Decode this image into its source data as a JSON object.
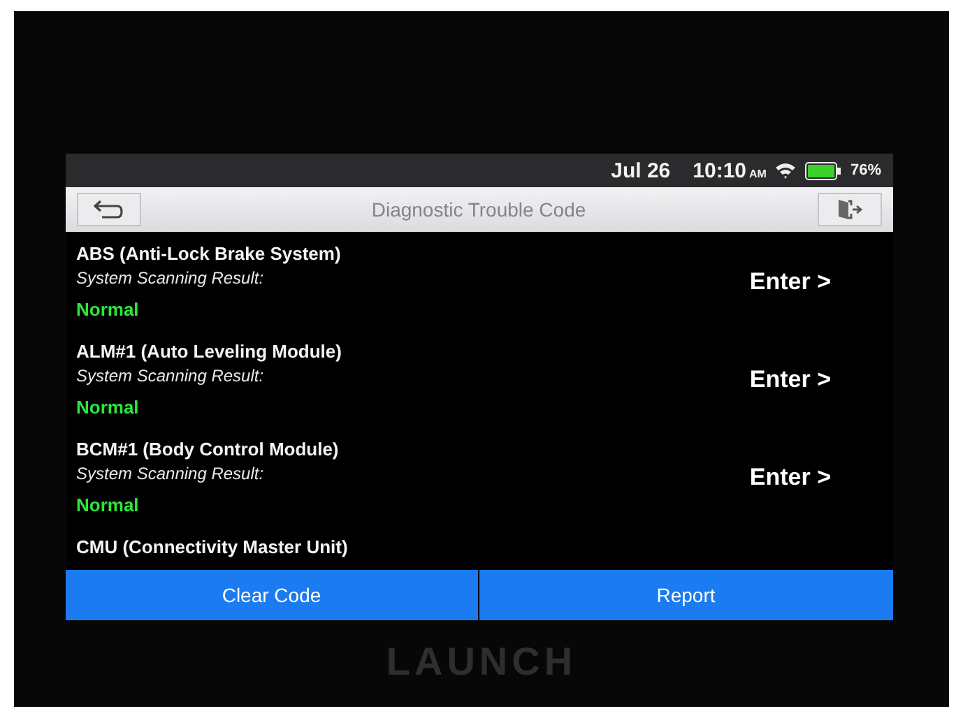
{
  "status_bar": {
    "date": "Jul 26",
    "time": "10:10",
    "ampm": "AM",
    "battery": "76%"
  },
  "title_bar": {
    "title": "Diagnostic Trouble Code"
  },
  "systems": [
    {
      "name": "ABS (Anti-Lock Brake System)",
      "result_label": "System Scanning Result:",
      "result": "Normal",
      "action": "Enter >"
    },
    {
      "name": "ALM#1 (Auto Leveling Module)",
      "result_label": "System Scanning Result:",
      "result": "Normal",
      "action": "Enter >"
    },
    {
      "name": "BCM#1 (Body Control Module)",
      "result_label": "System Scanning Result:",
      "result": "Normal",
      "action": "Enter >"
    },
    {
      "name": "CMU (Connectivity Master Unit)"
    }
  ],
  "buttons": [
    "Clear Code",
    "Report"
  ],
  "device": {
    "brand": "LAUNCH"
  }
}
